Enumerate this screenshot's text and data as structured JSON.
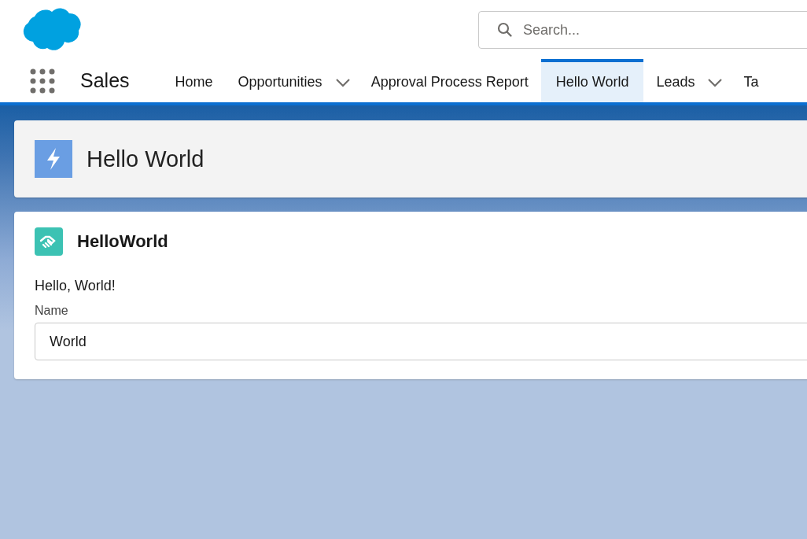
{
  "search": {
    "placeholder": "Search..."
  },
  "app_name": "Sales",
  "tabs": [
    {
      "label": "Home",
      "selected": false,
      "has_menu": false
    },
    {
      "label": "Opportunities",
      "selected": false,
      "has_menu": true
    },
    {
      "label": "Approval Process Report",
      "selected": false,
      "has_menu": false
    },
    {
      "label": "Hello World",
      "selected": true,
      "has_menu": false
    },
    {
      "label": "Leads",
      "selected": false,
      "has_menu": true
    },
    {
      "label": "Ta",
      "selected": false,
      "has_menu": false
    }
  ],
  "page_header": {
    "title": "Hello World"
  },
  "card": {
    "title": "HelloWorld",
    "greeting": "Hello, World!",
    "field": {
      "label": "Name",
      "value": "World"
    }
  }
}
